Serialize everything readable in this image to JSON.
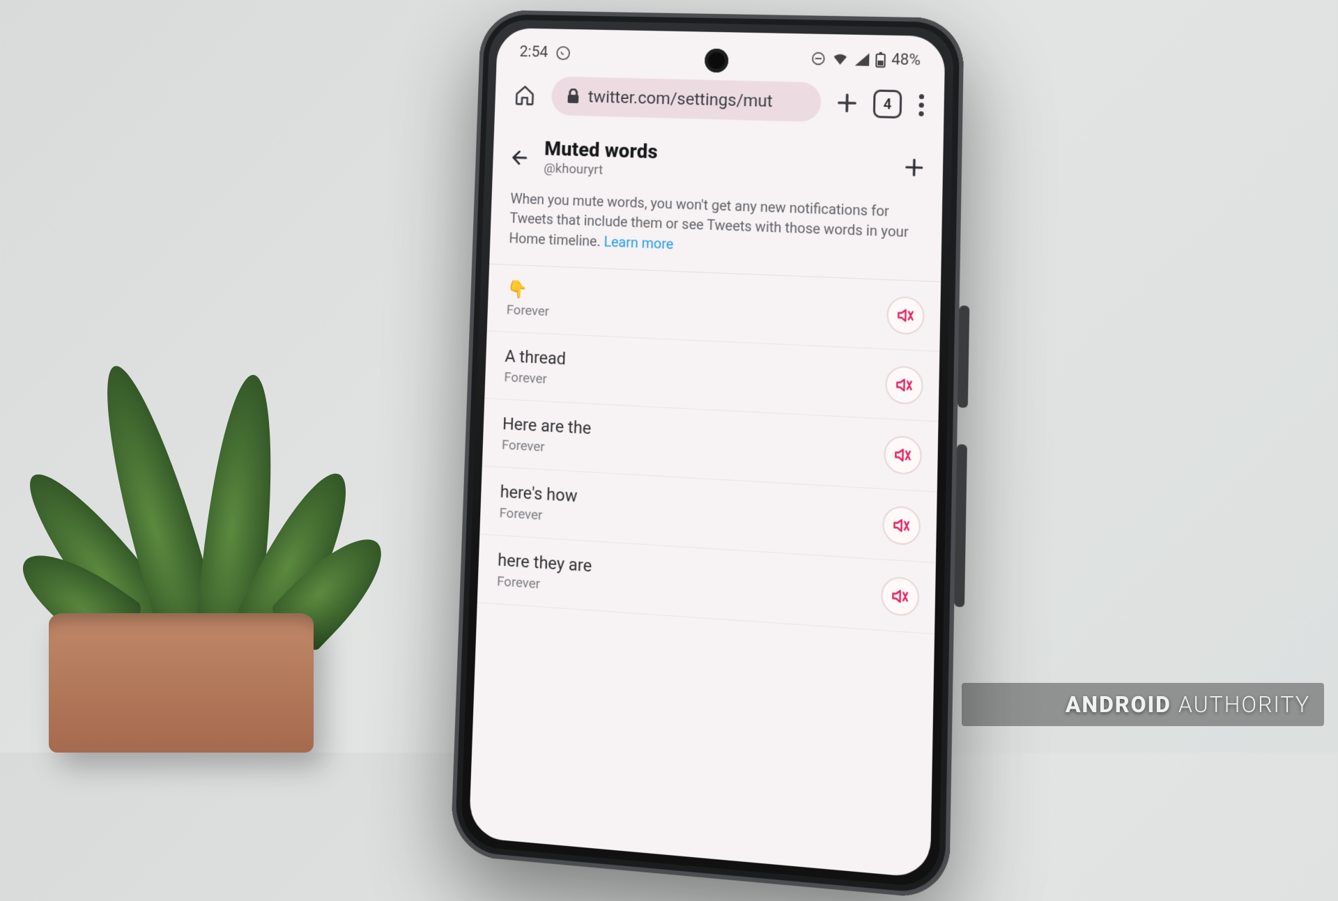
{
  "status_bar": {
    "time": "2:54",
    "whatsapp_icon": "whatsapp",
    "dnd_icon": "dnd",
    "wifi_icon": "wifi",
    "cell_icon": "cell",
    "battery_icon": "battery",
    "battery_text": "48%"
  },
  "browser": {
    "home_icon": "home",
    "lock_icon": "lock",
    "url": "twitter.com/settings/mut",
    "newtab_icon": "plus",
    "tab_count": "4",
    "menu_icon": "kebab"
  },
  "page_header": {
    "back_icon": "back-arrow",
    "title": "Muted words",
    "handle": "@khouryrt",
    "add_icon": "plus"
  },
  "description": {
    "text": "When you mute words, you won't get any new notifications for Tweets that include them or see Tweets with those words in your Home timeline. ",
    "learn_more": "Learn more"
  },
  "muted_items": [
    {
      "word": "👇",
      "duration": "Forever"
    },
    {
      "word": "A thread",
      "duration": "Forever"
    },
    {
      "word": "Here are the",
      "duration": "Forever"
    },
    {
      "word": "here's how",
      "duration": "Forever"
    },
    {
      "word": "here they are",
      "duration": "Forever"
    }
  ],
  "unmute_icon": "unmute",
  "watermark": {
    "brand": "ANDROID",
    "word": "AUTHORITY"
  },
  "colors": {
    "link": "#1d9bf0",
    "unmute": "#e0245e",
    "screen_bg": "#f7f2f3"
  }
}
